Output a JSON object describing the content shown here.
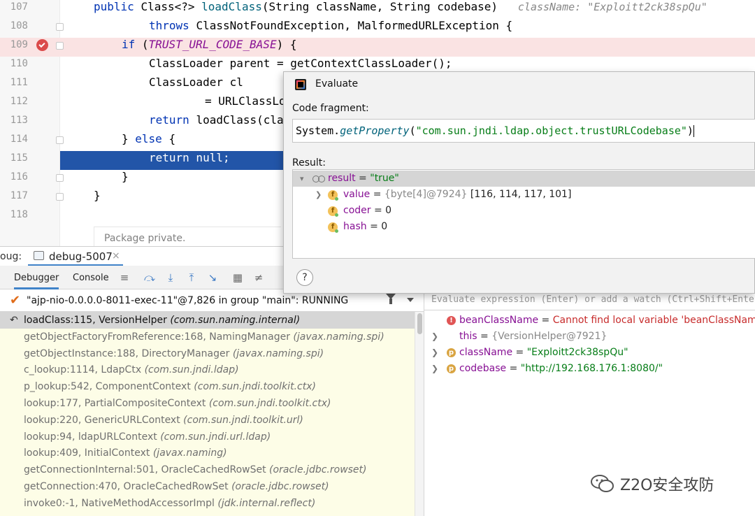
{
  "editor": {
    "lines": [
      {
        "num": "107",
        "parts": [
          [
            "kw",
            "public "
          ],
          [
            "",
            "Class<?> "
          ],
          [
            "method",
            "loadClass"
          ],
          [
            "",
            "(String className, String codebase)   "
          ],
          [
            "hint",
            "className: \"Exploitt2ck38spQu\""
          ]
        ]
      },
      {
        "num": "108",
        "parts": [
          [
            "kw",
            "throws "
          ],
          [
            "",
            "ClassNotFoundException, MalformedURLException {"
          ]
        ]
      },
      {
        "num": "109",
        "parts": [
          [
            "kw",
            "if "
          ],
          [
            "",
            "("
          ],
          [
            "const",
            "TRUST_URL_CODE_BASE"
          ],
          [
            "",
            ") {"
          ]
        ]
      },
      {
        "num": "110",
        "parts": [
          [
            "",
            "ClassLoader parent = getContextClassLoader();"
          ]
        ]
      },
      {
        "num": "111",
        "parts": [
          [
            "",
            "ClassLoader cl"
          ]
        ]
      },
      {
        "num": "112",
        "parts": [
          [
            "",
            "= URLClassLo"
          ]
        ]
      },
      {
        "num": "113",
        "parts": [
          [
            "kw",
            "return "
          ],
          [
            "",
            "loadClass(cla"
          ]
        ]
      },
      {
        "num": "114",
        "parts": [
          [
            "",
            "} "
          ],
          [
            "kw",
            "else "
          ],
          [
            "",
            "{"
          ]
        ]
      },
      {
        "num": "115",
        "parts": [
          [
            "",
            "return null;"
          ]
        ]
      },
      {
        "num": "116",
        "parts": [
          [
            "",
            "}"
          ]
        ]
      },
      {
        "num": "117",
        "parts": [
          [
            "",
            "}"
          ]
        ]
      },
      {
        "num": "118",
        "parts": []
      }
    ],
    "inlay_hint": "Package private."
  },
  "debug": {
    "label": "oug:",
    "session_tab": "debug-5007",
    "close_glyph": "×",
    "subtabs": [
      "Debugger",
      "Console"
    ],
    "thread": "\"ajp-nio-0.0.0.0-8011-exec-11\"@7,826 in group \"main\": RUNNING",
    "frames": [
      {
        "name": "loadClass:115, VersionHelper",
        "pkg": "(com.sun.naming.internal)"
      },
      {
        "name": "getObjectFactoryFromReference:168, NamingManager",
        "pkg": "(javax.naming.spi)"
      },
      {
        "name": "getObjectInstance:188, DirectoryManager",
        "pkg": "(javax.naming.spi)"
      },
      {
        "name": "c_lookup:1114, LdapCtx",
        "pkg": "(com.sun.jndi.ldap)"
      },
      {
        "name": "p_lookup:542, ComponentContext",
        "pkg": "(com.sun.jndi.toolkit.ctx)"
      },
      {
        "name": "lookup:177, PartialCompositeContext",
        "pkg": "(com.sun.jndi.toolkit.ctx)"
      },
      {
        "name": "lookup:220, GenericURLContext",
        "pkg": "(com.sun.jndi.toolkit.url)"
      },
      {
        "name": "lookup:94, ldapURLContext",
        "pkg": "(com.sun.jndi.url.ldap)"
      },
      {
        "name": "lookup:409, InitialContext",
        "pkg": "(javax.naming)"
      },
      {
        "name": "getConnectionInternal:501, OracleCachedRowSet",
        "pkg": "(oracle.jdbc.rowset)"
      },
      {
        "name": "getConnection:470, OracleCachedRowSet",
        "pkg": "(oracle.jdbc.rowset)"
      },
      {
        "name": "invoke0:-1, NativeMethodAccessorImpl",
        "pkg": "(jdk.internal.reflect)"
      }
    ],
    "eval_placeholder": "Evaluate expression (Enter) or add a watch (Ctrl+Shift+Enter)",
    "variables": {
      "beanClassName": {
        "name": "beanClassName",
        "eq": " = ",
        "value": "Cannot find local variable 'beanClassName'"
      },
      "this": {
        "name": "this",
        "eq": " = ",
        "value": "{VersionHelper@7921}"
      },
      "className": {
        "name": "className",
        "eq": " = ",
        "value": "\"Exploitt2ck38spQu\""
      },
      "codebase": {
        "name": "codebase",
        "eq": " = ",
        "value": "\"http://192.168.176.1:8080/\""
      }
    }
  },
  "evaluate_dialog": {
    "title": "Evaluate",
    "code_label": "Code fragment:",
    "code": {
      "cls": "System.",
      "method": "getProperty",
      "open": "(",
      "arg": "\"com.sun.jndi.ldap.object.trustURLCodebase\"",
      "close": ")"
    },
    "result_label": "Result:",
    "result": {
      "name": "result",
      "eq": " = ",
      "value": "\"true\""
    },
    "fields": [
      {
        "name": "value",
        "eq": " = ",
        "ref": "{byte[4]@7924}",
        "value": " [116, 114, 117, 101]"
      },
      {
        "name": "coder",
        "eq": " = ",
        "ref": "",
        "value": "0"
      },
      {
        "name": "hash",
        "eq": " = ",
        "ref": "",
        "value": "0"
      }
    ],
    "help": "?"
  },
  "watermark": "Z2O安全攻防",
  "colors": {
    "accent": "#4083c9",
    "exec_line": "#2255a8",
    "breakpoint": "#db4b4b",
    "frames_bg": "#fdfde7"
  }
}
